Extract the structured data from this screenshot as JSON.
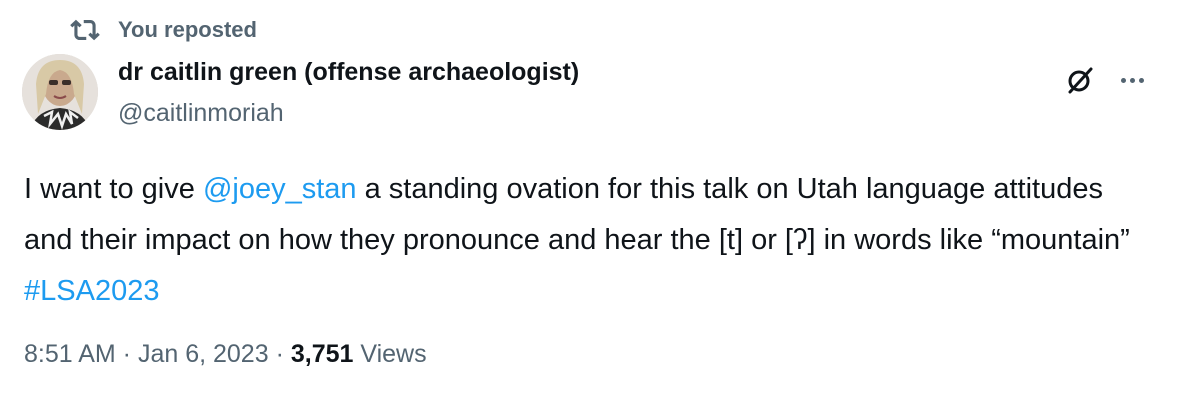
{
  "repost": {
    "label": "You reposted"
  },
  "author": {
    "display_name": "dr caitlin green (offense archaeologist)",
    "handle": "@caitlinmoriah"
  },
  "tweet": {
    "text_1": "I want to give ",
    "mention": "@joey_stan",
    "text_2": " a standing ovation for this talk on Utah language attitudes and their impact on how they pronounce and hear the [t] or [ʔ] in words like “mountain” ",
    "hashtag": "#LSA2023"
  },
  "meta": {
    "time": "8:51 AM",
    "sep1": " · ",
    "date": "Jan 6, 2023",
    "sep2": " · ",
    "views_count": "3,751",
    "views_label": " Views"
  },
  "colors": {
    "link": "#1d9bf0",
    "secondary_text": "#536471",
    "primary_text": "#0f1419"
  },
  "icons": {
    "repost": "repost-icon",
    "grok": "grok-icon",
    "more": "more-icon"
  }
}
